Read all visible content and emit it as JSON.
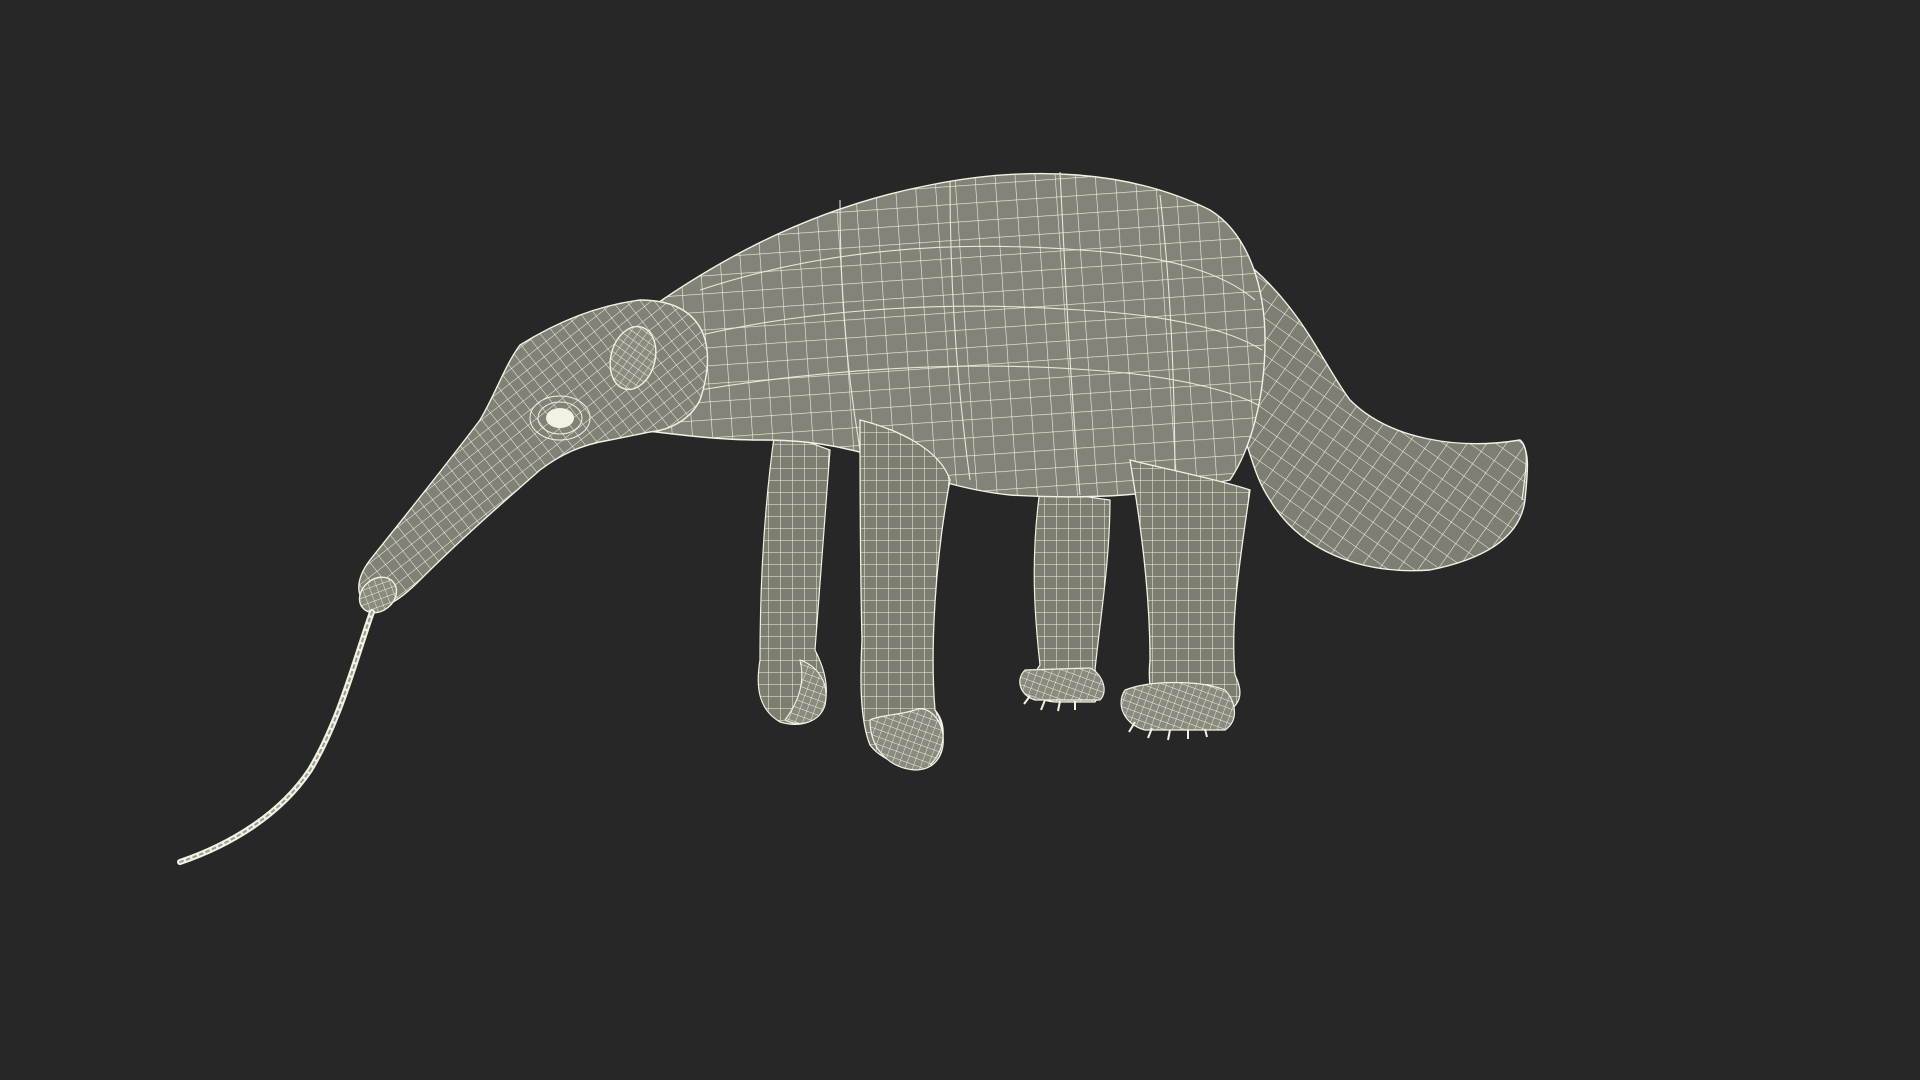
{
  "scene": {
    "background_color": "#272727",
    "mesh_fill_color": "#818176",
    "mesh_wire_color": "#f3f1e3",
    "mesh_shadow_color": "#6e6e64",
    "subject": "anteater-wireframe-model",
    "render_style": "wireframe-over-shaded"
  }
}
